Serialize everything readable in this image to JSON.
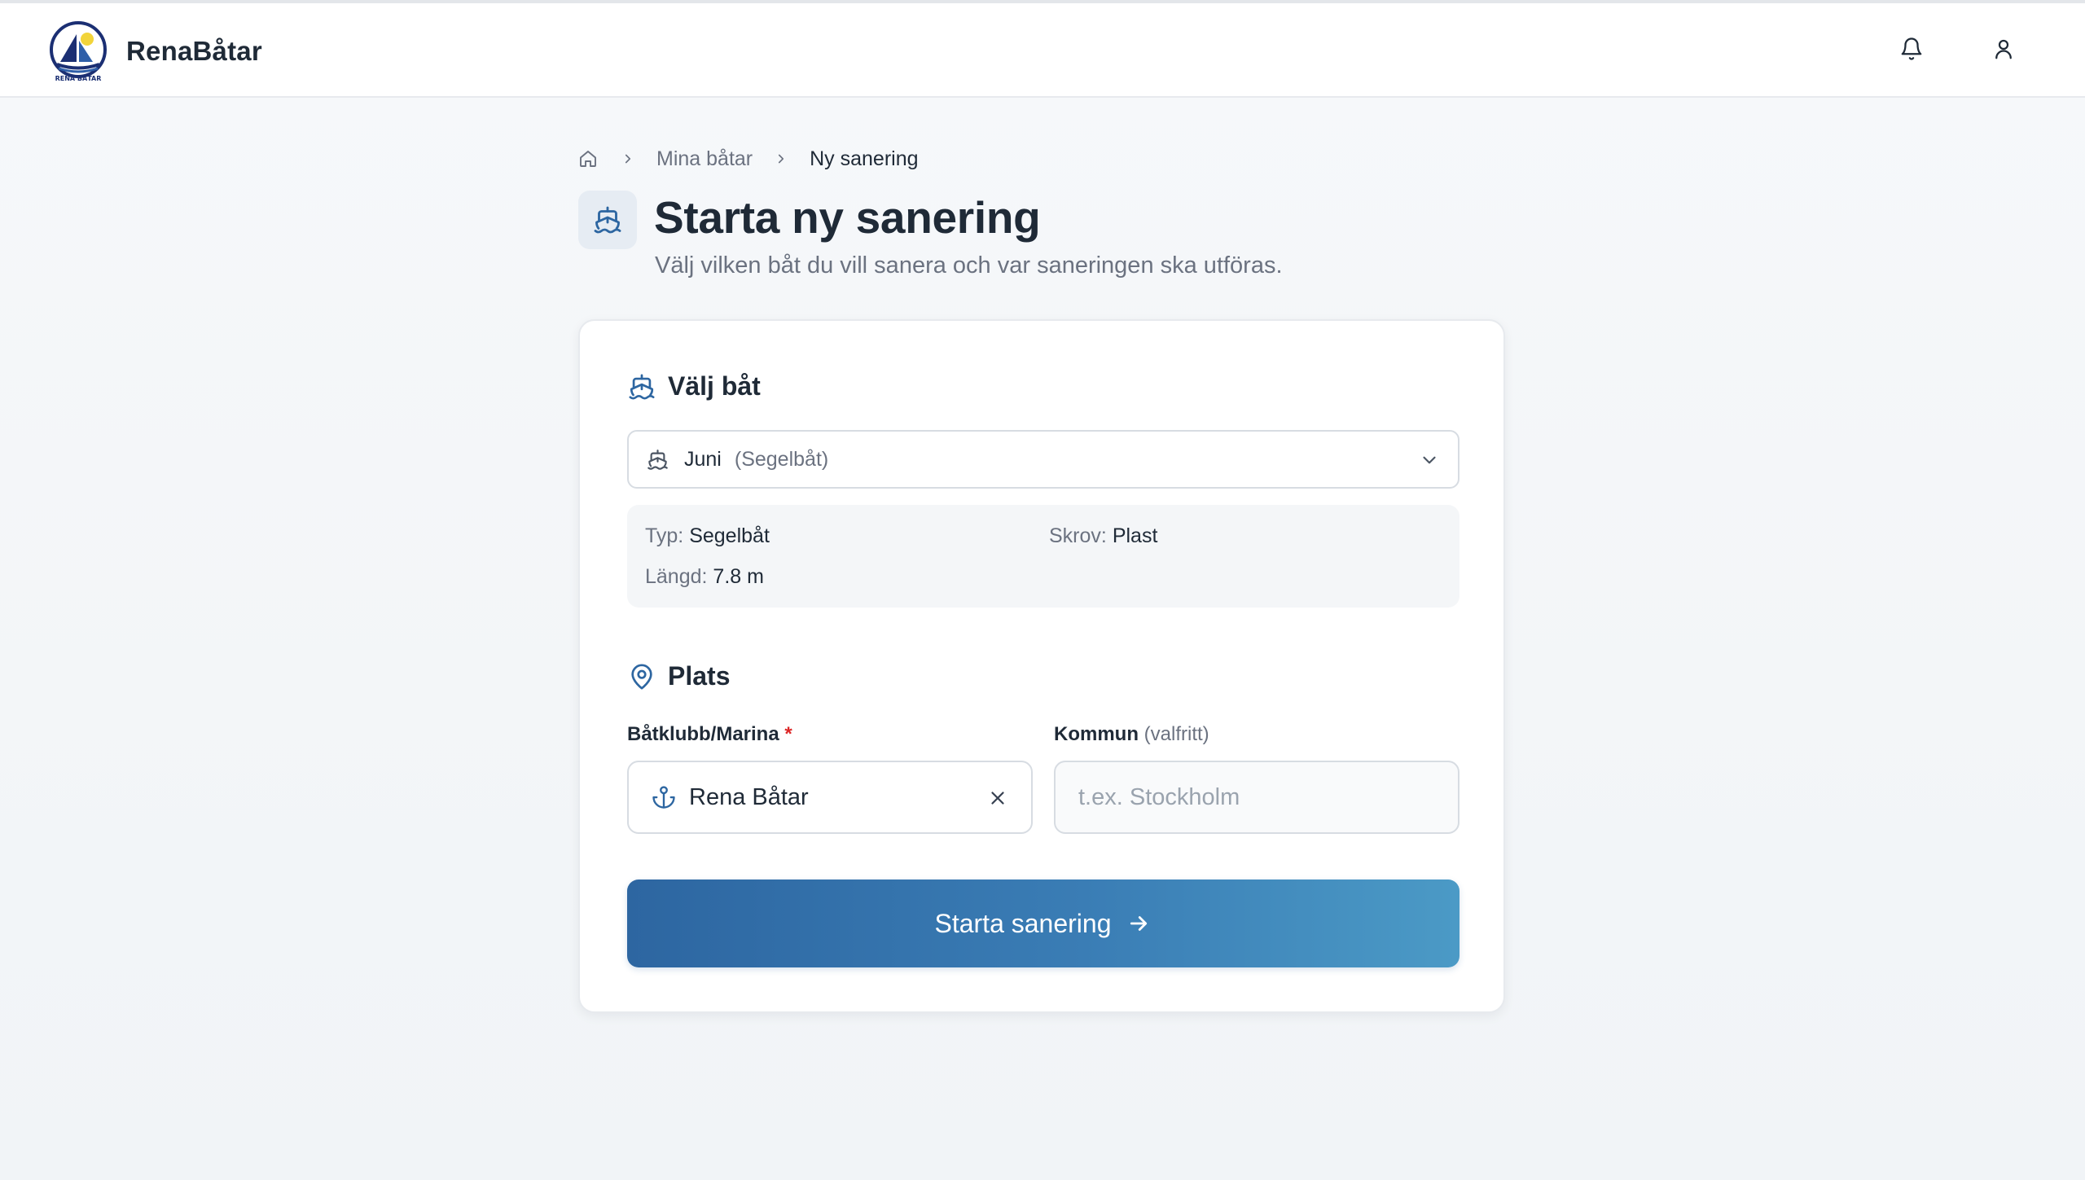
{
  "header": {
    "brand": "RenaBåtar",
    "logo_caption": "RENA BÅTAR",
    "icons": [
      "bell-icon",
      "user-icon"
    ]
  },
  "breadcrumb": {
    "home_icon": "home-icon",
    "items": [
      "Mina båtar",
      "Ny sanering"
    ]
  },
  "page": {
    "title": "Starta ny sanering",
    "subtitle": "Välj vilken båt du vill sanera och var saneringen ska utföras."
  },
  "boat_section": {
    "heading": "Välj båt",
    "select": {
      "name": "Juni",
      "type": "(Segelbåt)"
    },
    "details": {
      "typ_label": "Typ:",
      "typ_value": "Segelbåt",
      "skrov_label": "Skrov:",
      "skrov_value": "Plast",
      "langd_label": "Längd:",
      "langd_value": "7.8 m"
    }
  },
  "place_section": {
    "heading": "Plats",
    "club_label": "Båtklubb/Marina",
    "required_mark": "*",
    "club_value": "Rena Båtar",
    "kommun_label": "Kommun",
    "kommun_optional": "(valfritt)",
    "kommun_placeholder": "t.ex. Stockholm",
    "kommun_value": ""
  },
  "cta": {
    "label": "Starta sanering"
  },
  "colors": {
    "primary": "#2d66a1",
    "primary_light": "#4b9ac6",
    "required": "#dc2626",
    "text": "#1f2a37",
    "muted": "#6b7280"
  }
}
